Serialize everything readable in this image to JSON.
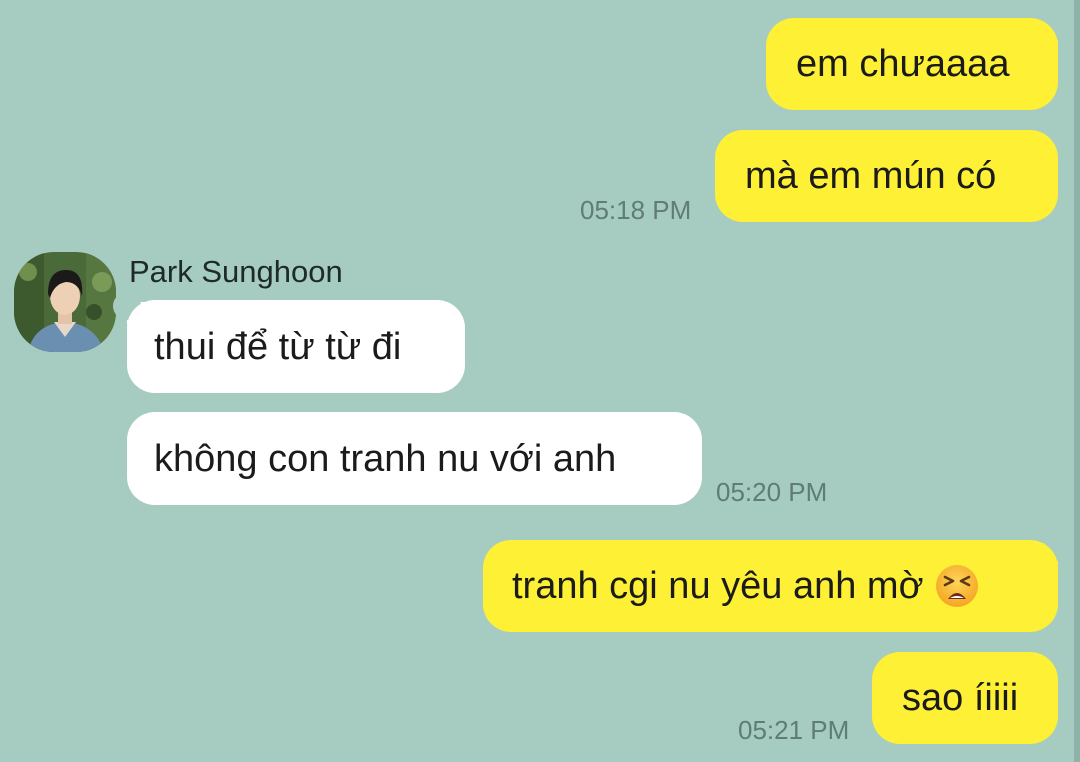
{
  "messages": [
    {
      "side": "out",
      "text": "em chưaaaa"
    },
    {
      "side": "out",
      "text": "mà em mún có",
      "time": "05:18 PM"
    },
    {
      "side": "in",
      "sender": "Park Sunghoon",
      "text": "thui để từ từ đi"
    },
    {
      "side": "in",
      "text": "không con tranh nu với anh",
      "time": "05:20 PM"
    },
    {
      "side": "out",
      "text": "tranh cgi nu yêu anh mờ",
      "emoji": "tired-face-emoji"
    },
    {
      "side": "out",
      "text": "sao íiiii",
      "time": "05:21 PM"
    }
  ],
  "colors": {
    "background": "#a6ccc1",
    "outgoing_bubble": "#fef035",
    "incoming_bubble": "#ffffff",
    "timestamp": "#5f7c75"
  }
}
